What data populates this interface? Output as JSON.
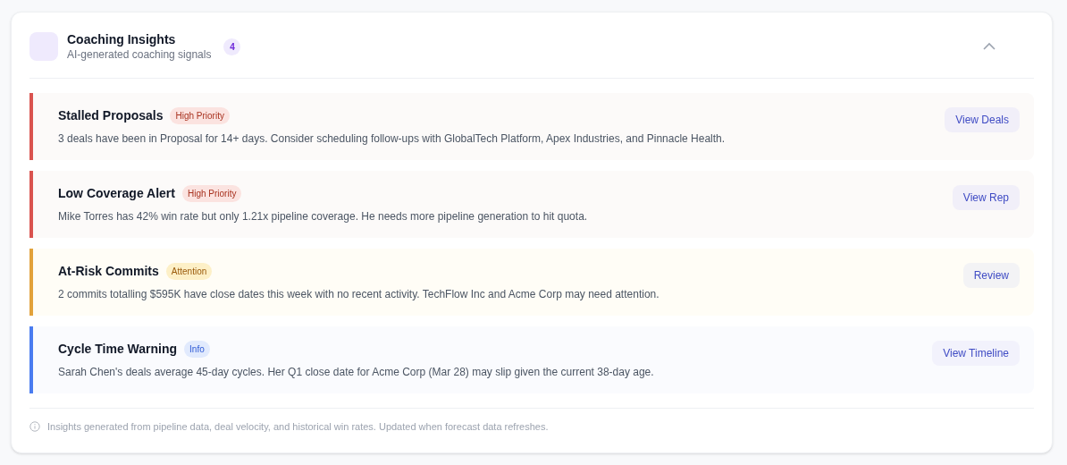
{
  "header": {
    "title": "Coaching Insights",
    "subtitle": "AI-generated coaching signals",
    "count": "4",
    "expanded": true
  },
  "insights": [
    {
      "kind": "high",
      "title": "Stalled Proposals",
      "badge": "High Priority",
      "text": "3 deals have been in Proposal for 14+ days. Consider scheduling follow-ups with GlobalTech Platform, Apex Industries, and Pinnacle Health.",
      "action": "View Deals"
    },
    {
      "kind": "high",
      "title": "Low Coverage Alert",
      "badge": "High Priority",
      "text": "Mike Torres has 42% win rate but only 1.21x pipeline coverage. He needs more pipeline generation to hit quota.",
      "action": "View Rep"
    },
    {
      "kind": "attention",
      "title": "At-Risk Commits",
      "badge": "Attention",
      "text": "2 commits totalling $595K have close dates this week with no recent activity. TechFlow Inc and Acme Corp may need attention.",
      "action": "Review"
    },
    {
      "kind": "info",
      "title": "Cycle Time Warning",
      "badge": "Info",
      "text": "Sarah Chen's deals average 45-day cycles. Her Q1 close date for Acme Corp (Mar 28) may slip given the current 38-day age.",
      "action": "View Timeline"
    }
  ],
  "footer": "Insights generated from pipeline data, deal velocity, and historical win rates. Updated when forecast data refreshes."
}
